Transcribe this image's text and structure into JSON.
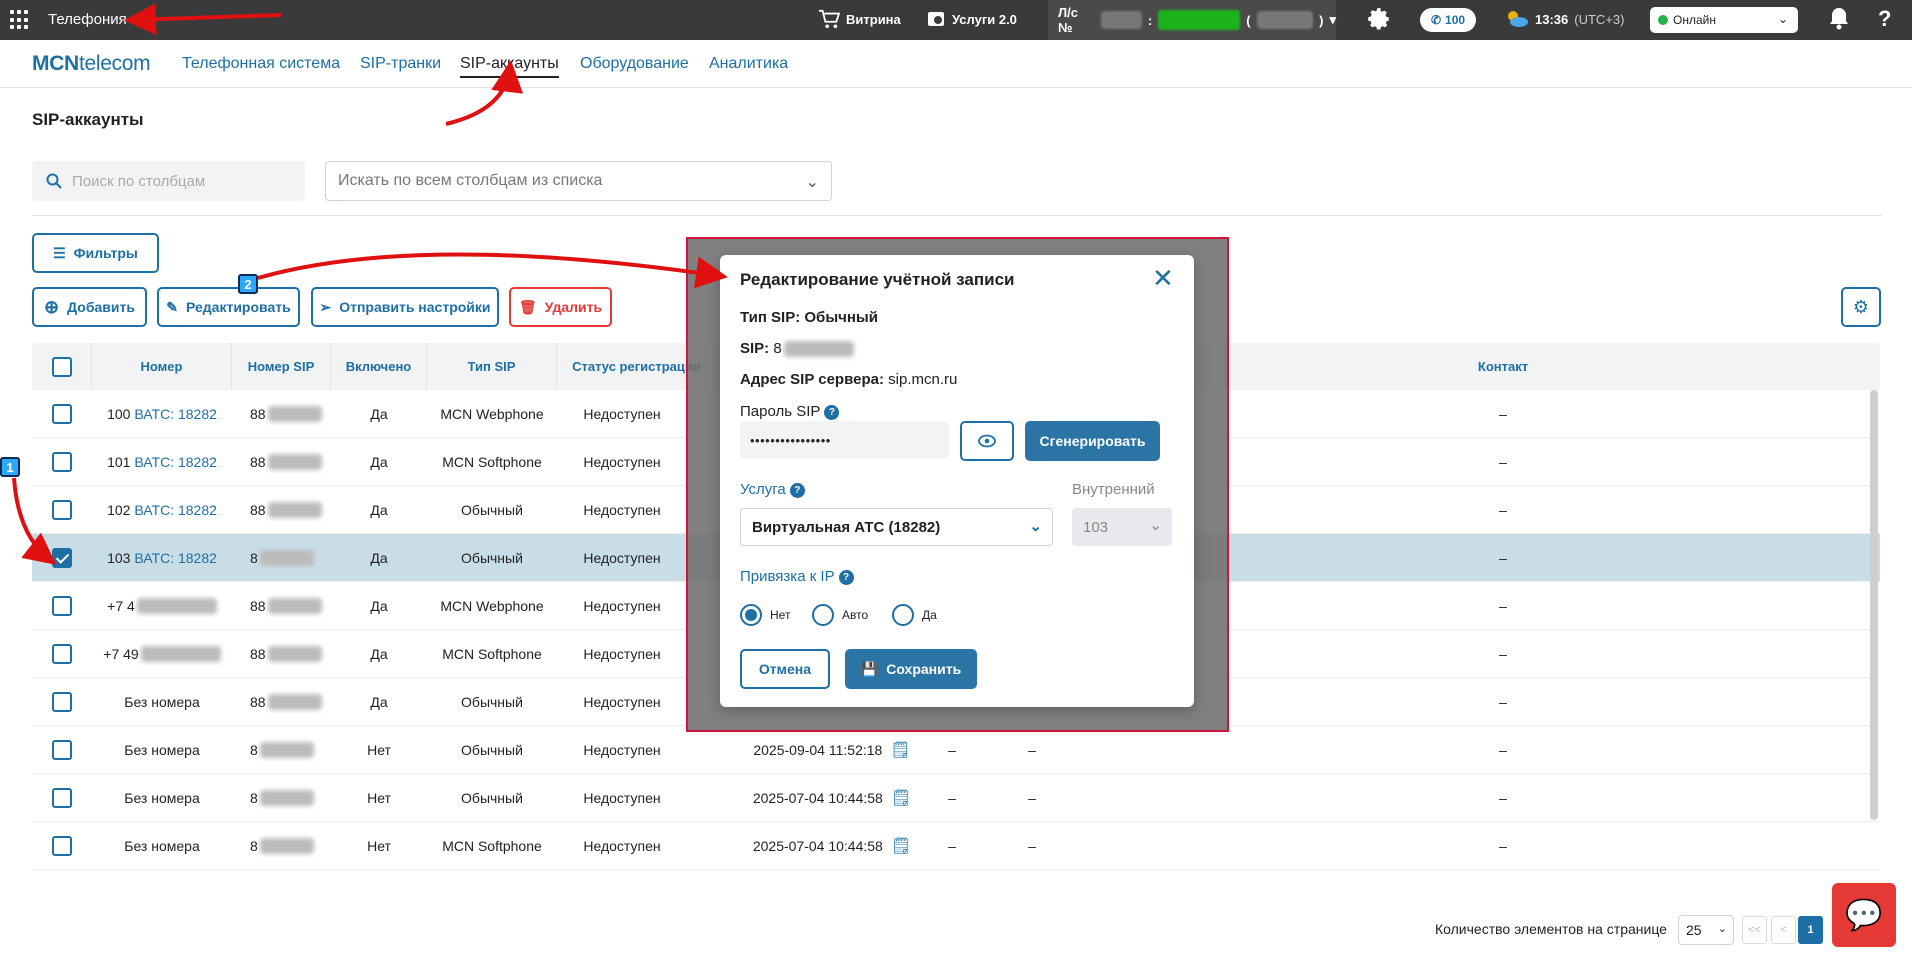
{
  "topbar": {
    "app_title": "Телефония",
    "showcase": "Витрина",
    "services": "Услуги 2.0",
    "account_prefix": "Л/с №",
    "account_sep": ":",
    "account_paren_open": "(",
    "account_paren_close": ")",
    "calls_badge": "100",
    "time": "13:36",
    "timezone": "(UTC+3)",
    "status": "Онлайн"
  },
  "nav": {
    "logo_bold": "MCN",
    "logo_rest": "telecom",
    "tabs": [
      {
        "label": "Телефонная система"
      },
      {
        "label": "SIP-транки"
      },
      {
        "label": "SIP-аккаунты"
      },
      {
        "label": "Оборудование"
      },
      {
        "label": "Аналитика"
      }
    ]
  },
  "page": {
    "title": "SIP-аккаунты",
    "search_placeholder": "Поиск по столбцам",
    "search_all": "Искать по всем столбцам из списка",
    "filters_btn": "Фильтры",
    "add_btn": "Добавить",
    "edit_btn": "Редактировать",
    "send_btn": "Отправить настройки",
    "delete_btn": "Удалить"
  },
  "table": {
    "columns": [
      "Номер",
      "Номер SIP",
      "Включено",
      "Тип SIP",
      "Статус регистрации",
      "Контакт"
    ],
    "rows": [
      {
        "num": "100",
        "link": "ВАТС: 18282",
        "sip": "88",
        "on": "Да",
        "type": "MCN Webphone",
        "status": "Недоступен",
        "date": "",
        "contact": "–",
        "checked": false
      },
      {
        "num": "101",
        "link": "ВАТС: 18282",
        "sip": "88",
        "on": "Да",
        "type": "MCN Softphone",
        "status": "Недоступен",
        "date": "",
        "contact": "–",
        "checked": false
      },
      {
        "num": "102",
        "link": "ВАТС: 18282",
        "sip": "88",
        "on": "Да",
        "type": "Обычный",
        "status": "Недоступен",
        "date": "",
        "contact": "–",
        "checked": false
      },
      {
        "num": "103",
        "link": "ВАТС: 18282",
        "sip": "8",
        "on": "Да",
        "type": "Обычный",
        "status": "Недоступен",
        "date": "",
        "contact": "–",
        "checked": true
      },
      {
        "num": "+7 4",
        "link": "",
        "sip": "88",
        "on": "Да",
        "type": "MCN Webphone",
        "status": "Недоступен",
        "date": "",
        "contact": "–",
        "checked": false
      },
      {
        "num": "+7 49",
        "link": "",
        "sip": "88",
        "on": "Да",
        "type": "MCN Softphone",
        "status": "Недоступен",
        "date": "",
        "contact": "–",
        "checked": false
      },
      {
        "num": "Без номера",
        "link": "",
        "sip": "88",
        "on": "Да",
        "type": "Обычный",
        "status": "Недоступен",
        "date": "",
        "contact": "–",
        "checked": false
      },
      {
        "num": "Без номера",
        "link": "",
        "sip": "8",
        "on": "Нет",
        "type": "Обычный",
        "status": "Недоступен",
        "date": "2025-09-04 11:52:18",
        "contact": "–",
        "checked": false
      },
      {
        "num": "Без номера",
        "link": "",
        "sip": "8",
        "on": "Нет",
        "type": "Обычный",
        "status": "Недоступен",
        "date": "2025-07-04 10:44:58",
        "contact": "–",
        "checked": false
      },
      {
        "num": "Без номера",
        "link": "",
        "sip": "8",
        "on": "Нет",
        "type": "MCN Softphone",
        "status": "Недоступен",
        "date": "2025-07-04 10:44:58",
        "contact": "–",
        "checked": false
      }
    ],
    "dash": "–"
  },
  "pager": {
    "label": "Количество элементов на странице",
    "per_page": "25",
    "first": "<<",
    "prev": "<",
    "current": "1"
  },
  "modal": {
    "title": "Редактирование учётной записи",
    "sip_type_label": "Тип SIP:",
    "sip_type_value": "Обычный",
    "sip_label": "SIP:",
    "sip_value": "8",
    "server_label": "Адрес SIP сервера:",
    "server_value": "sip.mcn.ru",
    "password_label": "Пароль SIP",
    "password_value": "••••••••••••••••",
    "generate_btn": "Сгенерировать",
    "service_label": "Услуга",
    "service_value": "Виртуальная АТС (18282)",
    "internal_label": "Внутренний",
    "internal_value": "103",
    "ip_label": "Привязка к IP",
    "ip_options": [
      "Нет",
      "Авто",
      "Да"
    ],
    "cancel_btn": "Отмена",
    "save_btn": "Сохранить"
  },
  "markers": [
    "1",
    "2"
  ],
  "colors": {
    "accent": "#1d6fa5",
    "danger": "#e53935",
    "topbar": "#3a3a3a",
    "selected_row": "#c9dde6",
    "highlight_border": "#d0143c"
  }
}
